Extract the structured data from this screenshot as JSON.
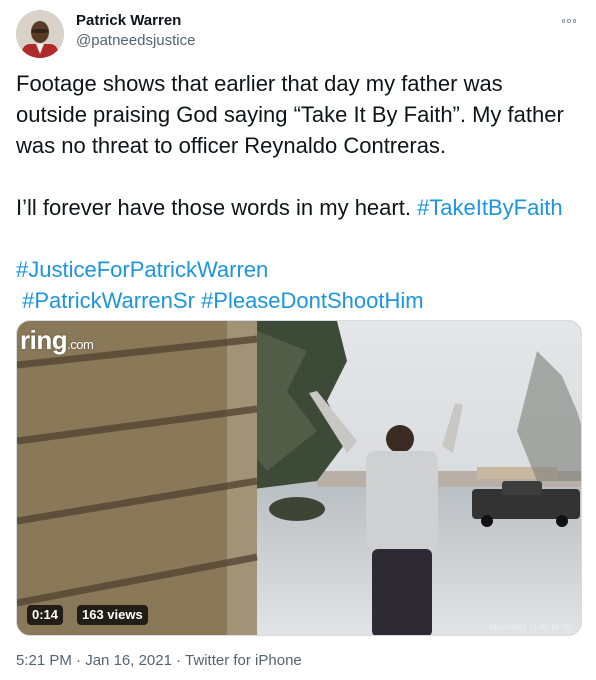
{
  "tweet": {
    "author_name": "Patrick Warren",
    "author_handle": "@patneedsjustice",
    "lines": [
      [
        {
          "text": "Footage shows that earlier that day my father was"
        }
      ],
      [
        {
          "text": "outside praising God saying “Take It By Faith”. My father"
        }
      ],
      [
        {
          "text": "was no threat to officer Reynaldo Contreras."
        }
      ],
      [
        {
          "text": ""
        }
      ],
      [
        {
          "text": "I’ll forever have those words in my heart. "
        },
        {
          "text": "#TakeItByFaith",
          "tag": true
        }
      ],
      [
        {
          "text": ""
        }
      ],
      [
        {
          "text": "#JusticeForPatrickWarren",
          "tag": true
        }
      ],
      [
        {
          "text": " "
        },
        {
          "text": "#PatrickWarrenSr",
          "tag": true
        },
        {
          "text": " "
        },
        {
          "text": "#PleaseDontShootHim",
          "tag": true
        }
      ]
    ]
  },
  "media": {
    "watermark": "ring",
    "watermark_suffix": ".com",
    "duration": "0:14",
    "views": "163 views",
    "camera_timestamp": "01/10/2021 12:03:03 CST"
  },
  "footer": {
    "time": "5:21 PM",
    "separator": " · ",
    "date": "Jan 16, 2021",
    "source": "Twitter for iPhone"
  },
  "colors": {
    "link": "#1b95e0",
    "text": "#0f1419",
    "secondary": "#536471"
  },
  "icons": [
    "more-options-icon"
  ]
}
